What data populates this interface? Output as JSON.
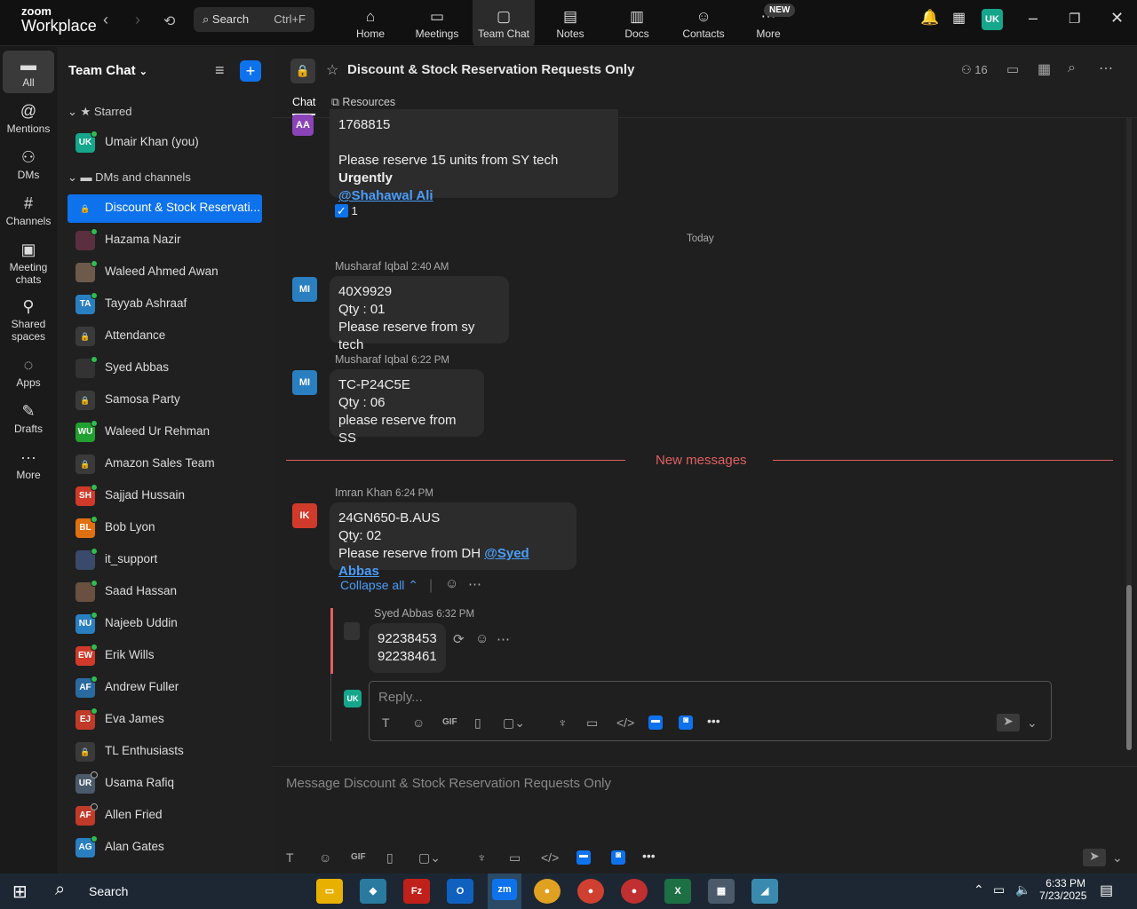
{
  "app": {
    "logo_top": "zoom",
    "logo_bottom": "Workplace"
  },
  "search": {
    "label": "Search",
    "shortcut": "Ctrl+F"
  },
  "topnav": {
    "tabs": [
      {
        "label": "Home",
        "icon": "home-icon"
      },
      {
        "label": "Meetings",
        "icon": "video-icon"
      },
      {
        "label": "Team Chat",
        "icon": "chat-icon"
      },
      {
        "label": "Notes",
        "icon": "notes-icon"
      },
      {
        "label": "Docs",
        "icon": "docs-icon"
      },
      {
        "label": "Contacts",
        "icon": "contacts-icon"
      },
      {
        "label": "More",
        "icon": "more-icon"
      }
    ],
    "new_badge": "NEW",
    "user_initials": "UK"
  },
  "leftrail": {
    "items": [
      {
        "label": "All"
      },
      {
        "label": "Mentions"
      },
      {
        "label": "DMs"
      },
      {
        "label": "Channels"
      },
      {
        "label": "Meeting chats"
      },
      {
        "label": "Shared spaces"
      },
      {
        "label": "Apps"
      },
      {
        "label": "Drafts"
      },
      {
        "label": "More"
      }
    ]
  },
  "sidebar": {
    "title": "Team Chat",
    "starred_label": "Starred",
    "starred": [
      {
        "label": "Umair Khan (you)",
        "initials": "UK",
        "color": "#15a68b"
      }
    ],
    "dms_label": "DMs and channels",
    "items": [
      {
        "label": "Discount & Stock Reservati...",
        "initials": "",
        "color": ""
      },
      {
        "label": "Hazama Nazir",
        "initials": "",
        "color": "#5a3040"
      },
      {
        "label": "Waleed Ahmed Awan",
        "initials": "",
        "color": "#6e5a4a"
      },
      {
        "label": "Tayyab Ashraaf",
        "initials": "TA",
        "color": "#2a7fc1"
      },
      {
        "label": "Attendance",
        "initials": "",
        "color": ""
      },
      {
        "label": "Syed Abbas",
        "initials": "",
        "color": "#333"
      },
      {
        "label": "Samosa Party",
        "initials": "",
        "color": ""
      },
      {
        "label": "Waleed Ur Rehman",
        "initials": "WU",
        "color": "#20a030"
      },
      {
        "label": "Amazon Sales Team",
        "initials": "",
        "color": ""
      },
      {
        "label": "Sajjad Hussain",
        "initials": "SH",
        "color": "#d03a2a"
      },
      {
        "label": "Bob Lyon",
        "initials": "BL",
        "color": "#e07010"
      },
      {
        "label": "it_support",
        "initials": "",
        "color": "#3a4a6a"
      },
      {
        "label": "Saad Hassan",
        "initials": "",
        "color": "#6a5040"
      },
      {
        "label": "Najeeb Uddin",
        "initials": "NU",
        "color": "#2a7fc1"
      },
      {
        "label": "Erik Wills",
        "initials": "EW",
        "color": "#d03a2a"
      },
      {
        "label": "Andrew Fuller",
        "initials": "AF",
        "color": "#2a6aa1"
      },
      {
        "label": "Eva James",
        "initials": "EJ",
        "color": "#c03a2a"
      },
      {
        "label": "TL Enthusiasts",
        "initials": "",
        "color": ""
      },
      {
        "label": "Usama Rafiq",
        "initials": "UR",
        "color": "#4a5a6a"
      },
      {
        "label": "Allen Fried",
        "initials": "AF",
        "color": "#c03a2a"
      },
      {
        "label": "Alan Gates",
        "initials": "AG",
        "color": "#2a7fc1"
      }
    ]
  },
  "channel": {
    "title": "Discount & Stock Reservation Requests Only",
    "member_count": "16",
    "tabs": [
      "Chat",
      "Resources"
    ]
  },
  "messages": {
    "m0": {
      "initials": "AA",
      "line1": "1768815",
      "line2": "Please reserve 15 units from SY tech",
      "bold": "Urgently",
      "mention": "@Shahawal Ali",
      "reaction": "1"
    },
    "date_divider": "Today",
    "m1": {
      "sender": "Musharaf Iqbal",
      "time": "2:40 AM",
      "initials": "MI",
      "lines": [
        "40X9929",
        "Qty : 01",
        "Please reserve from sy tech"
      ]
    },
    "m2": {
      "sender": "Musharaf Iqbal",
      "time": "6:22 PM",
      "initials": "MI",
      "lines": [
        "TC-P24C5E",
        "Qty : 06",
        "please reserve from SS"
      ]
    },
    "new_divider": "New messages",
    "m3": {
      "sender": "Imran Khan",
      "time": "6:24 PM",
      "initials": "IK",
      "lines": [
        "24GN650-B.AUS",
        "Qty: 02",
        "Please reserve from DH"
      ],
      "mention": "@Syed Abbas"
    },
    "collapse": "Collapse all",
    "reply": {
      "sender": "Syed Abbas",
      "time": "6:32 PM",
      "lines": [
        "92238453",
        "92238461"
      ]
    },
    "reply_placeholder": "Reply...",
    "reply_avatar": "UK"
  },
  "composer": {
    "placeholder": "Message Discount & Stock Reservation Requests Only"
  },
  "taskbar": {
    "search": "Search",
    "time": "6:33 PM",
    "date": "7/23/2025"
  }
}
